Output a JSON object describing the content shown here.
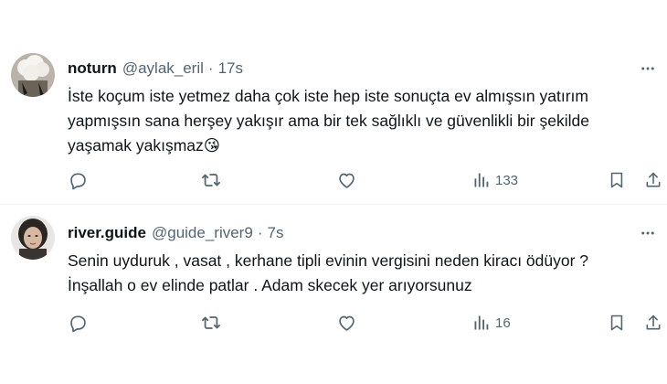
{
  "tweets": [
    {
      "name": "noturn",
      "handle": "@aylak_eril",
      "separator": "·",
      "time": "17s",
      "lines": [
        "İste koçum iste yetmez daha çok iste hep iste sonuçta ev almışsın yatırım",
        "yapmışsın sana herşey yakışır ama bir tek sağlıklı ve güvenlikli bir şekilde",
        "yaşamak yakışmaz😘"
      ],
      "views": "133"
    },
    {
      "name": "river.guide",
      "handle": "@guide_river9",
      "separator": "·",
      "time": "7s",
      "lines": [
        "Senin uyduruk , vasat , kerhane tipli evinin vergisini neden kiracı ödüyor ?",
        "İnşallah o ev elinde patlar . Adam skecek yer arıyorsunuz"
      ],
      "views": "16"
    }
  ],
  "icons": {
    "reply": "reply-icon",
    "retweet": "retweet-icon",
    "like": "like-icon",
    "views": "views-icon",
    "bookmark": "bookmark-icon",
    "share": "share-icon",
    "more": "more-icon"
  },
  "colors": {
    "text": "#0f1419",
    "secondary": "#536471",
    "divider": "#eff3f4"
  }
}
